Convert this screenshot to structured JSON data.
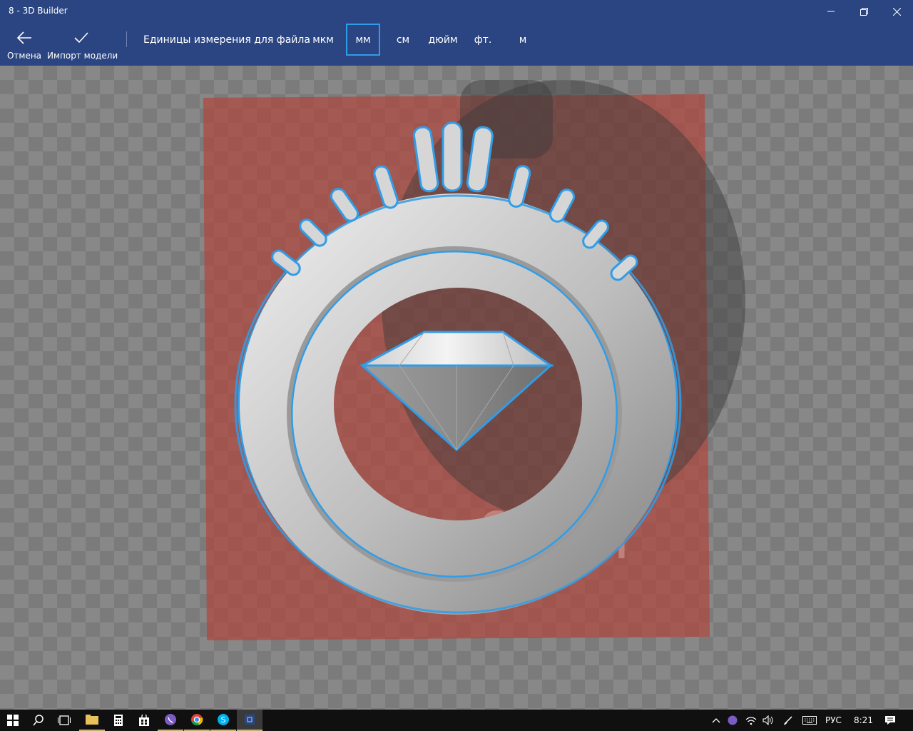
{
  "window": {
    "title": "8 - 3D Builder"
  },
  "toolbar": {
    "cancel_label": "Отмена",
    "import_label": "Импорт модели",
    "units_label": "Единицы измерения для файла",
    "units": [
      "мкм",
      "мм",
      "см",
      "дюйм",
      "фт.",
      "м"
    ],
    "selected_unit": "мм"
  },
  "viewport": {
    "size_label": "0 мм",
    "accent": "#2f9de8",
    "plate_color": "#b0463f"
  },
  "taskbar": {
    "language": "РУС",
    "time": "8:21",
    "apps": [
      "file-explorer-icon",
      "calculator-icon",
      "store-icon",
      "viber-icon",
      "chrome-icon",
      "skype-icon",
      "3d-builder-icon"
    ]
  }
}
